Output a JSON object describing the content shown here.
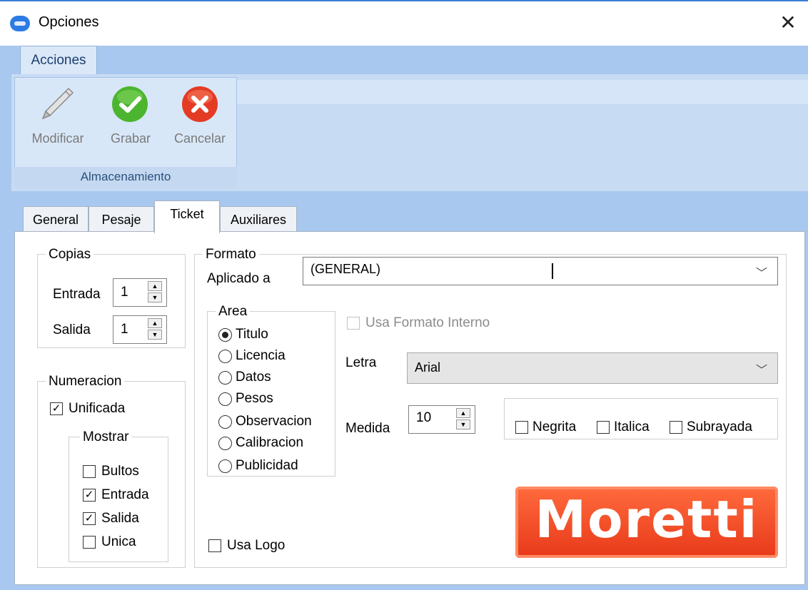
{
  "window": {
    "title": "Opciones",
    "close_glyph": "✕"
  },
  "ribbon": {
    "tab_label": "Acciones",
    "group_label": "Almacenamiento",
    "buttons": {
      "modificar": "Modificar",
      "grabar": "Grabar",
      "cancelar": "Cancelar"
    }
  },
  "tabs": {
    "general": "General",
    "pesaje": "Pesaje",
    "ticket": "Ticket",
    "auxiliares": "Auxiliares"
  },
  "copias": {
    "title": "Copias",
    "entrada_label": "Entrada",
    "entrada_value": "1",
    "salida_label": "Salida",
    "salida_value": "1"
  },
  "numeracion": {
    "title": "Numeracion",
    "unificada_label": "Unificada",
    "mostrar_title": "Mostrar",
    "items": [
      {
        "label": "Bultos",
        "checked": false
      },
      {
        "label": "Entrada",
        "checked": true
      },
      {
        "label": "Salida",
        "checked": true
      },
      {
        "label": "Unica",
        "checked": false
      }
    ]
  },
  "formato": {
    "title": "Formato",
    "aplicado_label": "Aplicado a",
    "aplicado_value": "(GENERAL)",
    "area_title": "Area",
    "areas": [
      "Titulo",
      "Licencia",
      "Datos",
      "Pesos",
      "Observacion",
      "Calibracion",
      "Publicidad"
    ],
    "selected_area": "Titulo",
    "usa_formato_interno": "Usa Formato Interno",
    "letra_label": "Letra",
    "letra_value": "Arial",
    "medida_label": "Medida",
    "medida_value": "10",
    "negrita": "Negrita",
    "italica": "Italica",
    "subrayada": "Subrayada",
    "usa_logo": "Usa Logo",
    "logo_text": "Moretti"
  },
  "icons": {
    "app": "app-icon",
    "modificar": "pencil-icon",
    "grabar": "check-circle-icon",
    "cancelar": "x-circle-icon"
  },
  "colors": {
    "grabar": "#44b02a",
    "cancelar": "#e33b22",
    "logo": "#f2522a"
  }
}
